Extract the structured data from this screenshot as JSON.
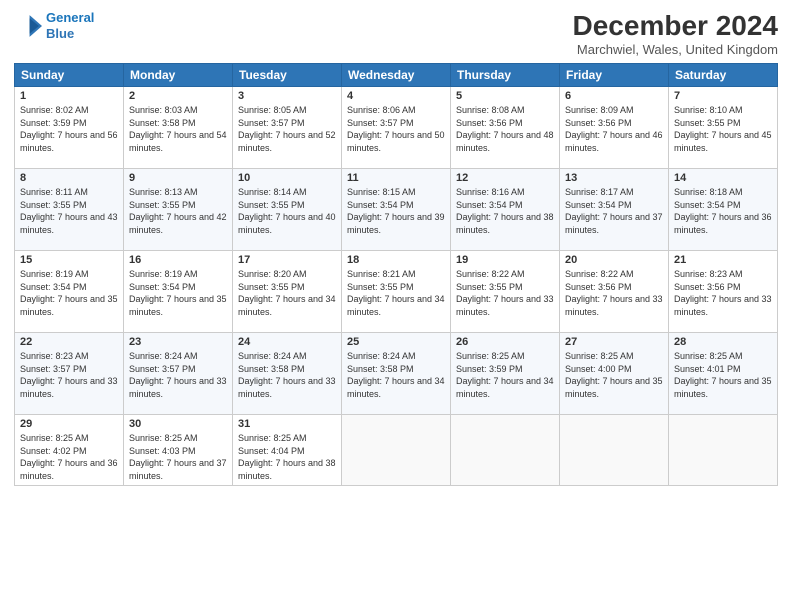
{
  "logo": {
    "line1": "General",
    "line2": "Blue"
  },
  "title": "December 2024",
  "location": "Marchwiel, Wales, United Kingdom",
  "days_of_week": [
    "Sunday",
    "Monday",
    "Tuesday",
    "Wednesday",
    "Thursday",
    "Friday",
    "Saturday"
  ],
  "weeks": [
    [
      {
        "day": "1",
        "sunrise": "Sunrise: 8:02 AM",
        "sunset": "Sunset: 3:59 PM",
        "daylight": "Daylight: 7 hours and 56 minutes."
      },
      {
        "day": "2",
        "sunrise": "Sunrise: 8:03 AM",
        "sunset": "Sunset: 3:58 PM",
        "daylight": "Daylight: 7 hours and 54 minutes."
      },
      {
        "day": "3",
        "sunrise": "Sunrise: 8:05 AM",
        "sunset": "Sunset: 3:57 PM",
        "daylight": "Daylight: 7 hours and 52 minutes."
      },
      {
        "day": "4",
        "sunrise": "Sunrise: 8:06 AM",
        "sunset": "Sunset: 3:57 PM",
        "daylight": "Daylight: 7 hours and 50 minutes."
      },
      {
        "day": "5",
        "sunrise": "Sunrise: 8:08 AM",
        "sunset": "Sunset: 3:56 PM",
        "daylight": "Daylight: 7 hours and 48 minutes."
      },
      {
        "day": "6",
        "sunrise": "Sunrise: 8:09 AM",
        "sunset": "Sunset: 3:56 PM",
        "daylight": "Daylight: 7 hours and 46 minutes."
      },
      {
        "day": "7",
        "sunrise": "Sunrise: 8:10 AM",
        "sunset": "Sunset: 3:55 PM",
        "daylight": "Daylight: 7 hours and 45 minutes."
      }
    ],
    [
      {
        "day": "8",
        "sunrise": "Sunrise: 8:11 AM",
        "sunset": "Sunset: 3:55 PM",
        "daylight": "Daylight: 7 hours and 43 minutes."
      },
      {
        "day": "9",
        "sunrise": "Sunrise: 8:13 AM",
        "sunset": "Sunset: 3:55 PM",
        "daylight": "Daylight: 7 hours and 42 minutes."
      },
      {
        "day": "10",
        "sunrise": "Sunrise: 8:14 AM",
        "sunset": "Sunset: 3:55 PM",
        "daylight": "Daylight: 7 hours and 40 minutes."
      },
      {
        "day": "11",
        "sunrise": "Sunrise: 8:15 AM",
        "sunset": "Sunset: 3:54 PM",
        "daylight": "Daylight: 7 hours and 39 minutes."
      },
      {
        "day": "12",
        "sunrise": "Sunrise: 8:16 AM",
        "sunset": "Sunset: 3:54 PM",
        "daylight": "Daylight: 7 hours and 38 minutes."
      },
      {
        "day": "13",
        "sunrise": "Sunrise: 8:17 AM",
        "sunset": "Sunset: 3:54 PM",
        "daylight": "Daylight: 7 hours and 37 minutes."
      },
      {
        "day": "14",
        "sunrise": "Sunrise: 8:18 AM",
        "sunset": "Sunset: 3:54 PM",
        "daylight": "Daylight: 7 hours and 36 minutes."
      }
    ],
    [
      {
        "day": "15",
        "sunrise": "Sunrise: 8:19 AM",
        "sunset": "Sunset: 3:54 PM",
        "daylight": "Daylight: 7 hours and 35 minutes."
      },
      {
        "day": "16",
        "sunrise": "Sunrise: 8:19 AM",
        "sunset": "Sunset: 3:54 PM",
        "daylight": "Daylight: 7 hours and 35 minutes."
      },
      {
        "day": "17",
        "sunrise": "Sunrise: 8:20 AM",
        "sunset": "Sunset: 3:55 PM",
        "daylight": "Daylight: 7 hours and 34 minutes."
      },
      {
        "day": "18",
        "sunrise": "Sunrise: 8:21 AM",
        "sunset": "Sunset: 3:55 PM",
        "daylight": "Daylight: 7 hours and 34 minutes."
      },
      {
        "day": "19",
        "sunrise": "Sunrise: 8:22 AM",
        "sunset": "Sunset: 3:55 PM",
        "daylight": "Daylight: 7 hours and 33 minutes."
      },
      {
        "day": "20",
        "sunrise": "Sunrise: 8:22 AM",
        "sunset": "Sunset: 3:56 PM",
        "daylight": "Daylight: 7 hours and 33 minutes."
      },
      {
        "day": "21",
        "sunrise": "Sunrise: 8:23 AM",
        "sunset": "Sunset: 3:56 PM",
        "daylight": "Daylight: 7 hours and 33 minutes."
      }
    ],
    [
      {
        "day": "22",
        "sunrise": "Sunrise: 8:23 AM",
        "sunset": "Sunset: 3:57 PM",
        "daylight": "Daylight: 7 hours and 33 minutes."
      },
      {
        "day": "23",
        "sunrise": "Sunrise: 8:24 AM",
        "sunset": "Sunset: 3:57 PM",
        "daylight": "Daylight: 7 hours and 33 minutes."
      },
      {
        "day": "24",
        "sunrise": "Sunrise: 8:24 AM",
        "sunset": "Sunset: 3:58 PM",
        "daylight": "Daylight: 7 hours and 33 minutes."
      },
      {
        "day": "25",
        "sunrise": "Sunrise: 8:24 AM",
        "sunset": "Sunset: 3:58 PM",
        "daylight": "Daylight: 7 hours and 34 minutes."
      },
      {
        "day": "26",
        "sunrise": "Sunrise: 8:25 AM",
        "sunset": "Sunset: 3:59 PM",
        "daylight": "Daylight: 7 hours and 34 minutes."
      },
      {
        "day": "27",
        "sunrise": "Sunrise: 8:25 AM",
        "sunset": "Sunset: 4:00 PM",
        "daylight": "Daylight: 7 hours and 35 minutes."
      },
      {
        "day": "28",
        "sunrise": "Sunrise: 8:25 AM",
        "sunset": "Sunset: 4:01 PM",
        "daylight": "Daylight: 7 hours and 35 minutes."
      }
    ],
    [
      {
        "day": "29",
        "sunrise": "Sunrise: 8:25 AM",
        "sunset": "Sunset: 4:02 PM",
        "daylight": "Daylight: 7 hours and 36 minutes."
      },
      {
        "day": "30",
        "sunrise": "Sunrise: 8:25 AM",
        "sunset": "Sunset: 4:03 PM",
        "daylight": "Daylight: 7 hours and 37 minutes."
      },
      {
        "day": "31",
        "sunrise": "Sunrise: 8:25 AM",
        "sunset": "Sunset: 4:04 PM",
        "daylight": "Daylight: 7 hours and 38 minutes."
      },
      null,
      null,
      null,
      null
    ]
  ]
}
